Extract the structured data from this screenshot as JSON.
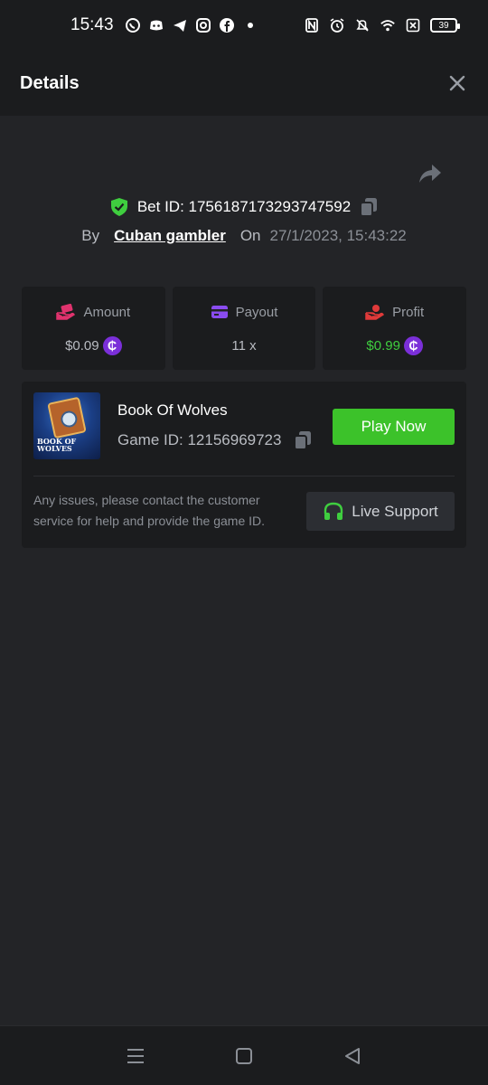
{
  "status_bar": {
    "time": "15:43",
    "battery": "39",
    "left_icons": [
      "whatsapp-icon",
      "discord-icon",
      "telegram-icon",
      "instagram-icon",
      "facebook-icon",
      "dot-icon"
    ],
    "right_icons": [
      "nfc-icon",
      "alarm-icon",
      "bell-off-icon",
      "wifi-icon",
      "sim-off-icon",
      "battery-icon"
    ]
  },
  "header": {
    "title": "Details"
  },
  "bet": {
    "label": "Bet ID: 1756187173293747592",
    "by_label": "By",
    "username": "Cuban gambler",
    "on_label": "On",
    "date": "27/1/2023, 15:43:22"
  },
  "stats": {
    "amount": {
      "label": "Amount",
      "value": "$0.09",
      "coin": "₵",
      "icon_color": "#e0336e"
    },
    "payout": {
      "label": "Payout",
      "value": "11 x",
      "icon_color": "#8a4cf0"
    },
    "profit": {
      "label": "Profit",
      "value": "$0.99",
      "coin": "₵",
      "icon_color": "#e03a3a",
      "value_color": "#3fce3f"
    }
  },
  "game": {
    "name": "Book Of Wolves",
    "id_label": "Game ID: 12156969723",
    "thumb_text_line1": "BOOK OF",
    "thumb_text_line2": "WOLVES",
    "play_label": "Play Now",
    "issue_text": "Any issues, please contact the customer service for help and provide the game ID.",
    "support_label": "Live Support"
  },
  "colors": {
    "accent_green": "#3cc22a",
    "coin_purple": "#7b2fd9",
    "background": "#232427",
    "card": "#1b1c1e"
  }
}
